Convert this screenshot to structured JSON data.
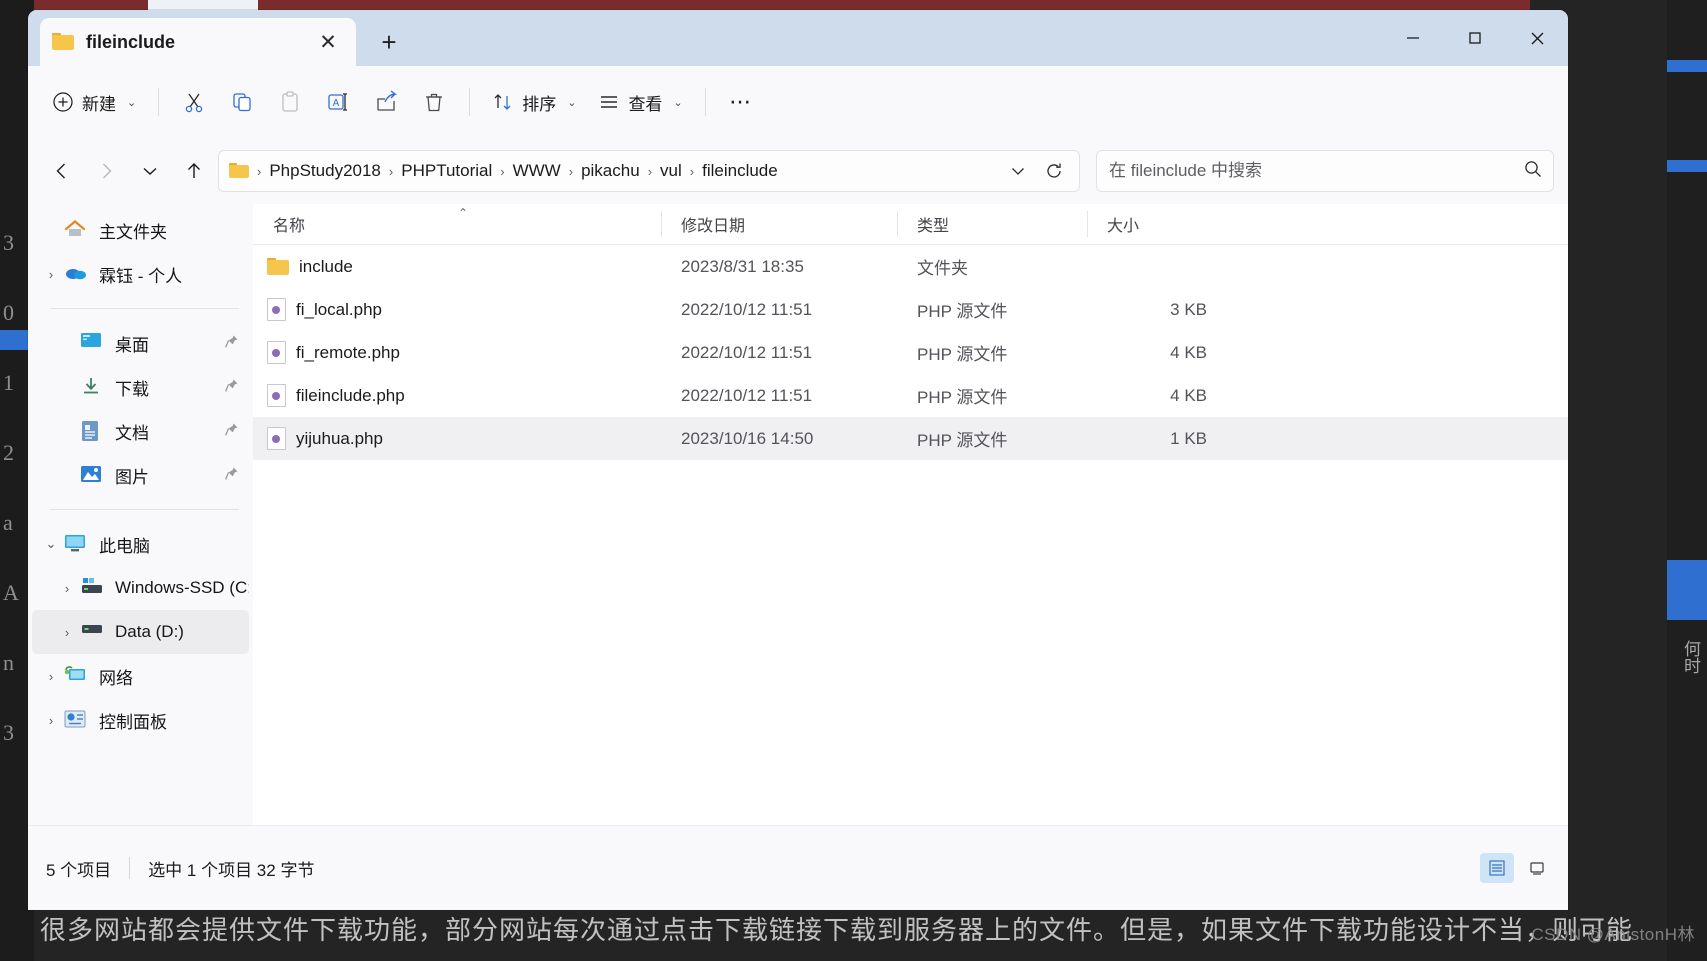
{
  "window": {
    "tab_title": "fileinclude",
    "tab_close_label": "✕",
    "new_tab_label": "+",
    "minimize_label": "—",
    "maximize_label": "□",
    "close_label": "✕"
  },
  "toolbar": {
    "new_label": "新建",
    "cut_label": "",
    "copy_label": "",
    "paste_label": "",
    "rename_label": "",
    "share_label": "",
    "delete_label": "",
    "sort_label": "排序",
    "view_label": "查看",
    "more_label": "⋯"
  },
  "address": {
    "crumbs": [
      "PhpStudy2018",
      "PHPTutorial",
      "WWW",
      "pikachu",
      "vul",
      "fileinclude"
    ],
    "separator": "›",
    "dropdown_label": "⌄",
    "refresh_label": "⟳",
    "back_label": "←",
    "forward_label": "→",
    "recent_label": "⌄",
    "up_label": "↑"
  },
  "search": {
    "placeholder": "在 fileinclude 中搜索",
    "value": "",
    "icon_label": "search-icon"
  },
  "sidebar": {
    "items": [
      {
        "label": "主文件夹",
        "icon": "home-icon",
        "expander": "",
        "pinned": false,
        "indent": false,
        "selected": false
      },
      {
        "label": "霖钰 - 个人",
        "icon": "onedrive-icon",
        "expander": "›",
        "pinned": false,
        "indent": false,
        "selected": false
      },
      {
        "divider": true
      },
      {
        "label": "桌面",
        "icon": "desktop-icon",
        "expander": "",
        "pinned": true,
        "indent": true,
        "selected": false
      },
      {
        "label": "下载",
        "icon": "downloads-icon",
        "expander": "",
        "pinned": true,
        "indent": true,
        "selected": false
      },
      {
        "label": "文档",
        "icon": "documents-icon",
        "expander": "",
        "pinned": true,
        "indent": true,
        "selected": false
      },
      {
        "label": "图片",
        "icon": "pictures-icon",
        "expander": "",
        "pinned": true,
        "indent": true,
        "selected": false
      },
      {
        "divider": true
      },
      {
        "label": "此电脑",
        "icon": "pc-icon",
        "expander": "⌄",
        "pinned": false,
        "indent": false,
        "selected": false
      },
      {
        "label": "Windows-SSD (C:)",
        "icon": "windows-drive-icon",
        "expander": "›",
        "pinned": false,
        "indent": true,
        "selected": false
      },
      {
        "label": "Data (D:)",
        "icon": "drive-icon",
        "expander": "›",
        "pinned": false,
        "indent": true,
        "selected": true
      },
      {
        "label": "网络",
        "icon": "network-icon",
        "expander": "›",
        "pinned": false,
        "indent": false,
        "selected": false
      },
      {
        "label": "控制面板",
        "icon": "control-panel-icon",
        "expander": "›",
        "pinned": false,
        "indent": false,
        "selected": false
      }
    ],
    "pin_glyph": "📌"
  },
  "filelist": {
    "columns": [
      "名称",
      "修改日期",
      "类型",
      "大小"
    ],
    "sort_indicator": "⌃",
    "rows": [
      {
        "name": "include",
        "date": "2023/8/31 18:35",
        "type": "文件夹",
        "size": "",
        "icon": "folder-icon",
        "selected": false
      },
      {
        "name": "fi_local.php",
        "date": "2022/10/12 11:51",
        "type": "PHP 源文件",
        "size": "3 KB",
        "icon": "php-file-icon",
        "selected": false
      },
      {
        "name": "fi_remote.php",
        "date": "2022/10/12 11:51",
        "type": "PHP 源文件",
        "size": "4 KB",
        "icon": "php-file-icon",
        "selected": false
      },
      {
        "name": "fileinclude.php",
        "date": "2022/10/12 11:51",
        "type": "PHP 源文件",
        "size": "4 KB",
        "icon": "php-file-icon",
        "selected": false
      },
      {
        "name": "yijuhua.php",
        "date": "2023/10/16 14:50",
        "type": "PHP 源文件",
        "size": "1 KB",
        "icon": "php-file-icon",
        "selected": true
      }
    ]
  },
  "statusbar": {
    "item_count": "5 个项目",
    "selection": "选中 1 个项目  32 字节",
    "details_view_label": "details-view-icon",
    "large_icons_view_label": "large-icons-view-icon"
  },
  "background": {
    "bottom_text": "很多网站都会提供文件下载功能，部分网站每次通过点击下载链接下载到服务器上的文件。但是，如果文件下载功能设计不当，则可能",
    "right_text": "何时",
    "left_digits": [
      "3",
      "0",
      "1",
      "2",
      "a",
      "A",
      "n",
      "3"
    ]
  },
  "watermark": "CSDN @AnistonH林"
}
